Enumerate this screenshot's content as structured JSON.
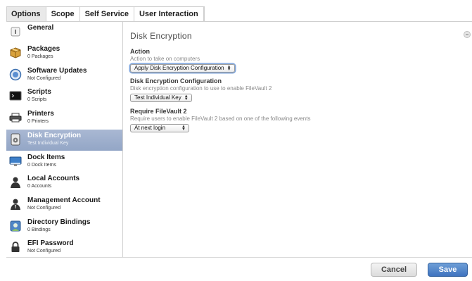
{
  "tabs": [
    {
      "label": "Options"
    },
    {
      "label": "Scope"
    },
    {
      "label": "Self Service"
    },
    {
      "label": "User Interaction"
    }
  ],
  "sidebar": {
    "items": [
      {
        "title": "General",
        "sub": "",
        "icon": "general-icon"
      },
      {
        "title": "Packages",
        "sub": "0 Packages",
        "icon": "package-icon"
      },
      {
        "title": "Software Updates",
        "sub": "Not Configured",
        "icon": "software-update-icon"
      },
      {
        "title": "Scripts",
        "sub": "0 Scripts",
        "icon": "terminal-icon"
      },
      {
        "title": "Printers",
        "sub": "0 Printers",
        "icon": "printer-icon"
      },
      {
        "title": "Disk Encryption",
        "sub": "Test Individual Key",
        "icon": "disk-encryption-icon"
      },
      {
        "title": "Dock Items",
        "sub": "0 Dock Items",
        "icon": "dock-icon"
      },
      {
        "title": "Local Accounts",
        "sub": "0 Accounts",
        "icon": "user-icon"
      },
      {
        "title": "Management Account",
        "sub": "Not Configured",
        "icon": "admin-user-icon"
      },
      {
        "title": "Directory Bindings",
        "sub": "0 Bindings",
        "icon": "directory-icon"
      },
      {
        "title": "EFI Password",
        "sub": "Not Configured",
        "icon": "lock-icon"
      }
    ]
  },
  "main": {
    "title": "Disk Encryption",
    "action": {
      "label": "Action",
      "desc": "Action to take on computers",
      "value": "Apply Disk Encryption Configuration"
    },
    "config": {
      "label": "Disk Encryption Configuration",
      "desc": "Disk encryption configuration to use to enable FileVault 2",
      "value": "Test Individual Key"
    },
    "filevault": {
      "label": "Require FileVault 2",
      "desc": "Require users to enable FileVault 2 based on one of the following events",
      "value": "At next login"
    }
  },
  "footer": {
    "cancel_label": "Cancel",
    "save_label": "Save"
  },
  "colors": {
    "selected_item": "#9cadcb",
    "save_button": "#4a7fc8"
  }
}
